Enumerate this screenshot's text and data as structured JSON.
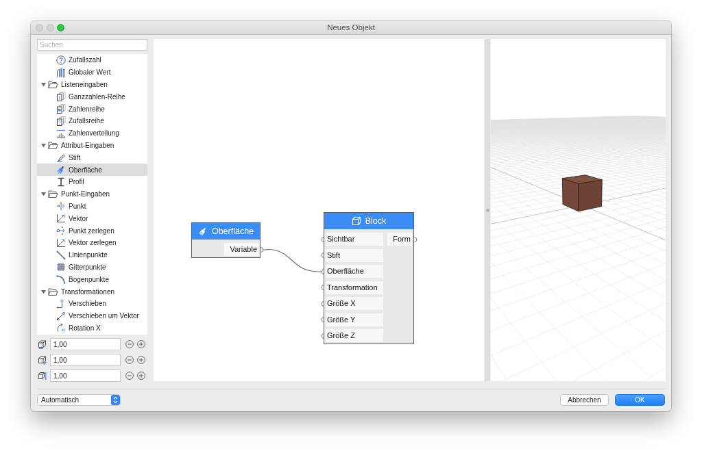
{
  "window": {
    "title": "Neues Objekt",
    "controls": [
      {
        "kind": "close",
        "disabled": true
      },
      {
        "kind": "minimize",
        "disabled": true
      },
      {
        "kind": "zoom",
        "disabled": false
      }
    ]
  },
  "sidebar": {
    "search": {
      "placeholder": "Suchen"
    },
    "tree": [
      {
        "children": [
          {
            "label": "Zufallszahl",
            "selected": false
          },
          {
            "label": "Globaler Wert",
            "selected": false
          }
        ]
      },
      {
        "label": "Listeneingaben",
        "expanded": true,
        "children": [
          {
            "label": "Ganzzahlen-Reihe",
            "selected": false
          },
          {
            "label": "Zahlenreihe",
            "selected": false
          },
          {
            "label": "Zufallsreihe",
            "selected": false
          },
          {
            "label": "Zahlenverteilung",
            "selected": false
          }
        ]
      },
      {
        "label": "Attribut-Eingaben",
        "expanded": true,
        "children": [
          {
            "label": "Stift",
            "selected": false
          },
          {
            "label": "Oberfläche",
            "selected": true
          },
          {
            "label": "Profil",
            "selected": false
          }
        ]
      },
      {
        "label": "Punkt-Eingaben",
        "expanded": true,
        "children": [
          {
            "label": "Punkt",
            "selected": false
          },
          {
            "label": "Vektor",
            "selected": false
          },
          {
            "label": "Punkt zerlegen",
            "selected": false
          },
          {
            "label": "Vektor zerlegen",
            "selected": false
          },
          {
            "label": "Linienpunkte",
            "selected": false
          },
          {
            "label": "Gitterpunkte",
            "selected": false
          },
          {
            "label": "Bogenpunkte",
            "selected": false
          }
        ]
      },
      {
        "label": "Transformationen",
        "expanded": true,
        "children": [
          {
            "label": "Verschieben",
            "selected": false
          },
          {
            "label": "Verschieben um Vektor",
            "selected": false
          },
          {
            "label": "Rotation X",
            "selected": false
          }
        ]
      }
    ],
    "value_fields": [
      {
        "value": "1,00"
      },
      {
        "value": "1,00"
      },
      {
        "value": "1,00"
      }
    ]
  },
  "graph": {
    "nodes": [
      {
        "title": "Oberfläche",
        "outputs": [
          {
            "label": "Variable",
            "connected": true
          }
        ]
      },
      {
        "title": "Block",
        "inputs": [
          {
            "label": "Sichtbar",
            "connected": false
          },
          {
            "label": "Stift",
            "connected": false
          },
          {
            "label": "Oberfläche",
            "connected": true
          },
          {
            "label": "Transformation",
            "connected": false
          },
          {
            "label": "Größe X",
            "connected": false
          },
          {
            "label": "Größe Y",
            "connected": false
          },
          {
            "label": "Größe Z",
            "connected": false
          }
        ],
        "outputs": [
          {
            "label": "Form",
            "connected": false
          }
        ]
      }
    ]
  },
  "footer": {
    "popup": {
      "value": "Automatisch"
    },
    "buttons": [
      {
        "label": "Abbrechen",
        "kind": "normal"
      },
      {
        "label": "OK",
        "kind": "default"
      }
    ]
  }
}
